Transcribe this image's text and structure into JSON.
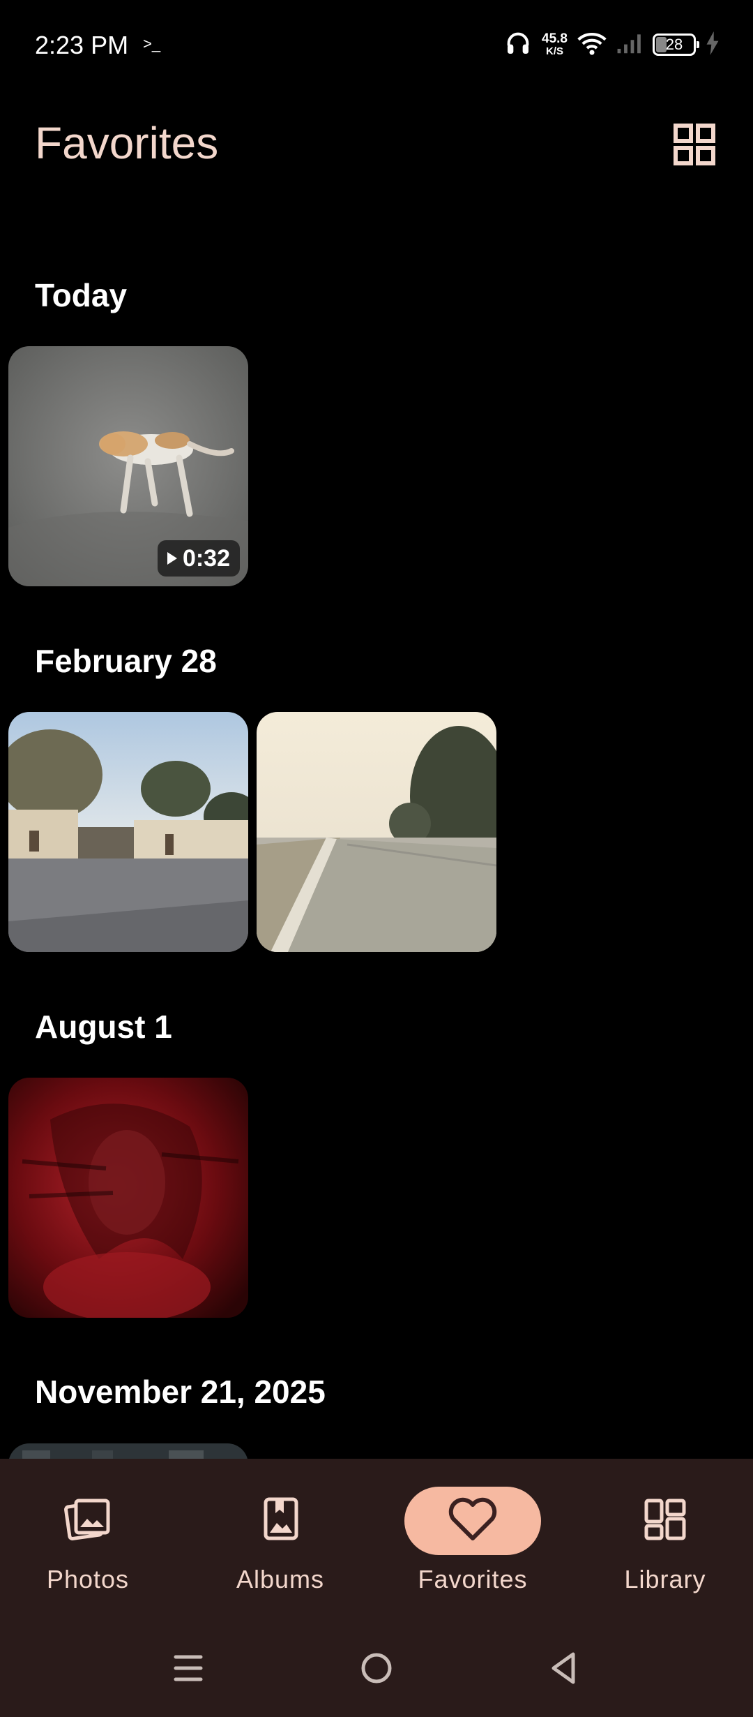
{
  "status_bar": {
    "time": "2:23 PM",
    "terminal_indicator": ">_",
    "net_speed_value": "45.8",
    "net_speed_unit": "K/S",
    "battery_level": "28",
    "battery_fraction": 0.28
  },
  "header": {
    "title": "Favorites",
    "layout_toggle_icon": "grid-view-icon"
  },
  "sections": [
    {
      "title": "Today",
      "items": [
        {
          "kind": "video",
          "duration": "0:32",
          "subject": "cat lying on concrete"
        }
      ]
    },
    {
      "title": "February 28",
      "items": [
        {
          "kind": "photo",
          "subject": "street with buildings and trees"
        },
        {
          "kind": "photo",
          "subject": "road with curb and trees"
        }
      ]
    },
    {
      "title": "August 1",
      "items": [
        {
          "kind": "photo",
          "subject": "red blurred portrait"
        }
      ]
    },
    {
      "title": "November 21, 2025",
      "items": [
        {
          "kind": "photo",
          "subject": "partially visible photo"
        }
      ]
    }
  ],
  "bottom_nav": {
    "items": [
      {
        "label": "Photos",
        "icon": "photos-icon",
        "active": false
      },
      {
        "label": "Albums",
        "icon": "albums-icon",
        "active": false
      },
      {
        "label": "Favorites",
        "icon": "heart-icon",
        "active": true
      },
      {
        "label": "Library",
        "icon": "library-icon",
        "active": false
      }
    ]
  },
  "system_nav": {
    "buttons": [
      "menu-icon",
      "home-icon",
      "back-icon"
    ]
  },
  "colors": {
    "background": "#000000",
    "title_text": "#f3d7cc",
    "nav_background": "#2a1b1a",
    "nav_active_pill": "#f6b9a1"
  }
}
